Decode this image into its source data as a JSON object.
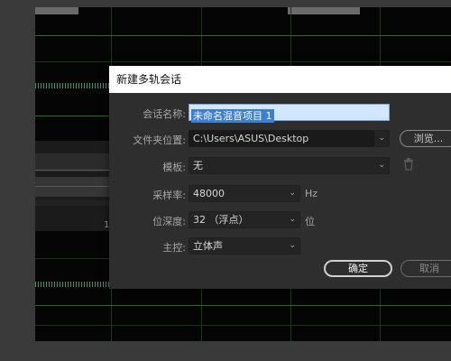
{
  "dialog": {
    "title": "新建多轨会话",
    "session_name": {
      "label": "会话名称:",
      "value": "未命名混音项目 1"
    },
    "folder": {
      "label": "文件夹位置:",
      "value": "C:\\Users\\ASUS\\Desktop",
      "browse_label": "浏览..."
    },
    "template": {
      "label": "模板:",
      "value": "无"
    },
    "sample_rate": {
      "label": "采样率:",
      "value": "48000",
      "unit": "Hz"
    },
    "bit_depth": {
      "label": "位深度:",
      "value": "32 （浮点）",
      "unit": "位"
    },
    "master": {
      "label": "主控:",
      "value": "立体声"
    },
    "ok_label": "确定",
    "cancel_label": "取消"
  },
  "editor": {
    "ruler_tick": "1"
  },
  "icons": {
    "dropdown": "chevron-down-icon",
    "delete": "trash-icon"
  },
  "colors": {
    "selection": "#3d7fd4",
    "waveform": "#4fb07a",
    "grid": "#2a6a2a"
  }
}
